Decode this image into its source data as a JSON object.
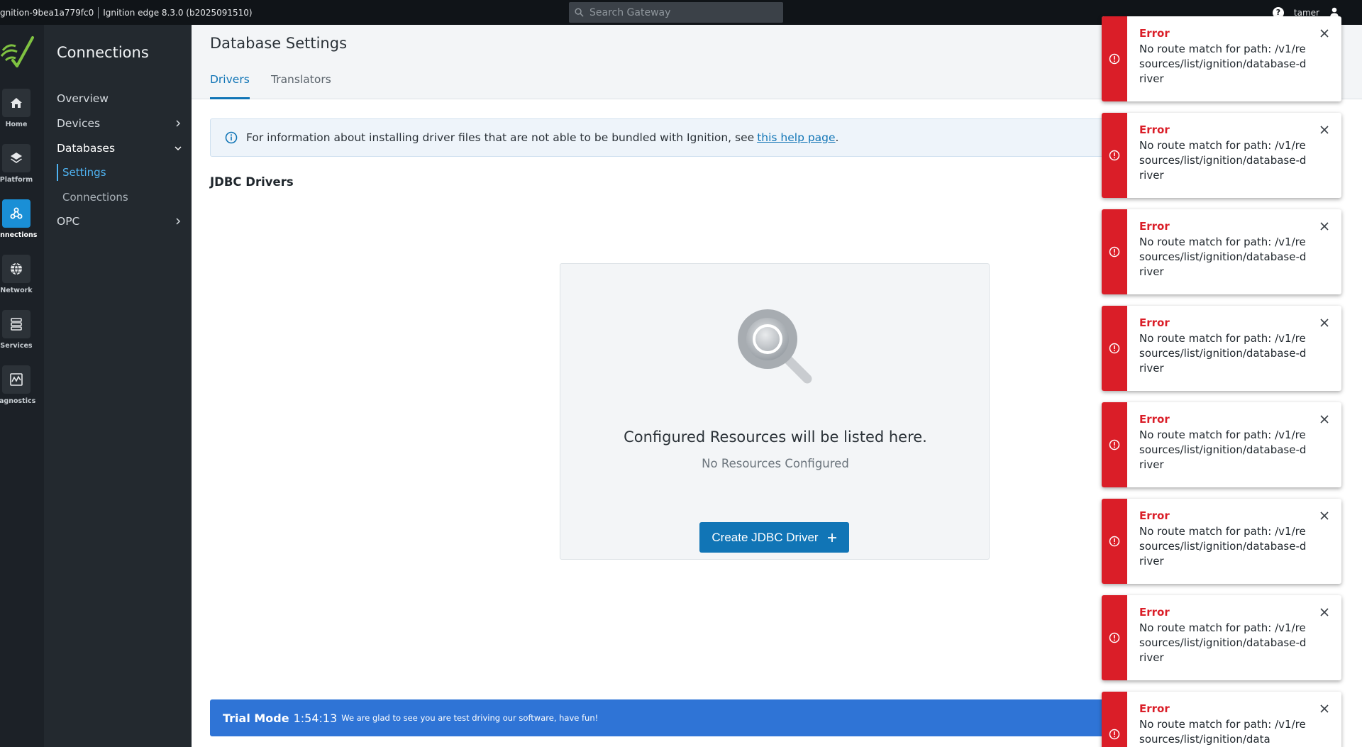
{
  "topbar": {
    "gateway_id": "gnition-9bea1a779fc0",
    "version": "Ignition edge 8.3.0 (b2025091510)",
    "search_placeholder": "Search Gateway",
    "help": "?",
    "username": "tamer"
  },
  "rail": {
    "items": [
      {
        "label": "Home",
        "icon": "home-icon"
      },
      {
        "label": "Platform",
        "icon": "layers-icon"
      },
      {
        "label": "onnections",
        "icon": "connections-icon"
      },
      {
        "label": "Network",
        "icon": "globe-icon"
      },
      {
        "label": "Services",
        "icon": "services-icon"
      },
      {
        "label": "iagnostics",
        "icon": "diagnostics-icon"
      }
    ]
  },
  "subnav": {
    "title": "Connections",
    "overview": "Overview",
    "devices": "Devices",
    "databases": "Databases",
    "settings": "Settings",
    "connections": "Connections",
    "opc": "OPC"
  },
  "main": {
    "page_title": "Database Settings",
    "tabs": [
      {
        "label": "Drivers"
      },
      {
        "label": "Translators"
      }
    ],
    "info": {
      "text": "For information about installing driver files that are not able to be bundled with Ignition, see",
      "link": "this help page",
      "end": "."
    },
    "section_title": "JDBC Drivers",
    "empty": {
      "heading": "Configured Resources will be listed here.",
      "sub": "No Resources Configured",
      "button": "Create JDBC Driver"
    },
    "trial": {
      "label": "Trial Mode",
      "time": "1:54:13",
      "message": "We are glad to see you are test driving our software, have fun!"
    }
  },
  "toasts": [
    {
      "title": "Error",
      "message": "No route match for path: /v1/resources/list/ignition/database-driver"
    },
    {
      "title": "Error",
      "message": "No route match for path: /v1/resources/list/ignition/database-driver"
    },
    {
      "title": "Error",
      "message": "No route match for path: /v1/resources/list/ignition/database-driver"
    },
    {
      "title": "Error",
      "message": "No route match for path: /v1/resources/list/ignition/database-driver"
    },
    {
      "title": "Error",
      "message": "No route match for path: /v1/resources/list/ignition/database-driver"
    },
    {
      "title": "Error",
      "message": "No route match for path: /v1/resources/list/ignition/database-driver"
    },
    {
      "title": "Error",
      "message": "No route match for path: /v1/resources/list/ignition/database-driver"
    },
    {
      "title": "Error",
      "message": "No route match for path: /v1/resources/list/ignition/data"
    }
  ],
  "colors": {
    "accent": "#1175b6",
    "error": "#da1e28",
    "trial": "#2f74d6",
    "rail_active": "#1a8fd6"
  }
}
